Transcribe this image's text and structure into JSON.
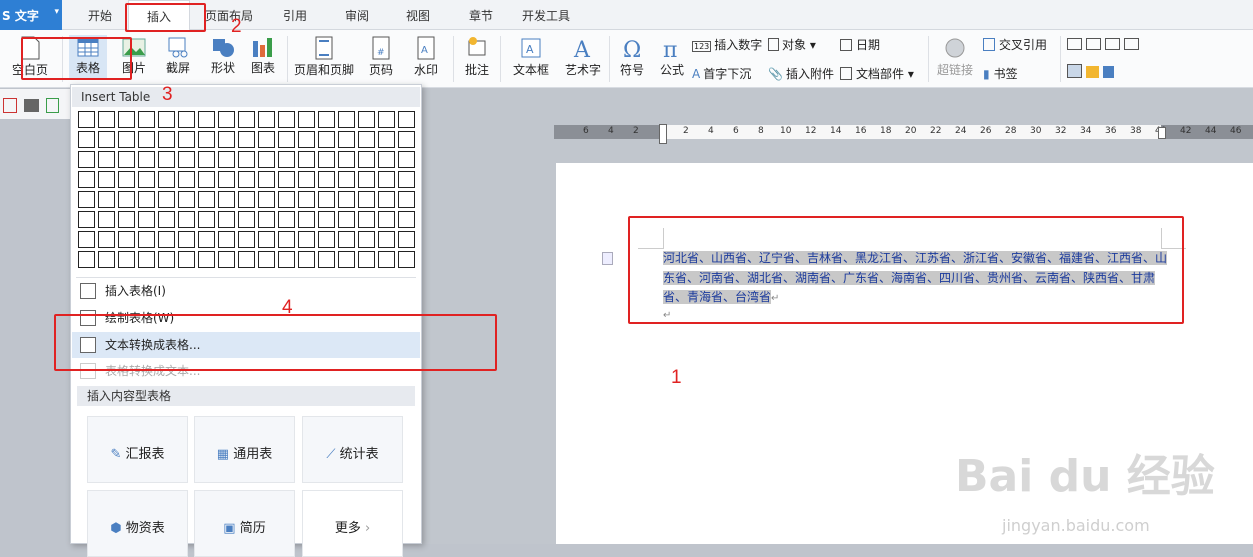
{
  "app": {
    "name": "S 文字"
  },
  "tabs": [
    "开始",
    "插入",
    "页面布局",
    "引用",
    "审阅",
    "视图",
    "章节",
    "开发工具"
  ],
  "ribbon": {
    "blank_page": "空白页",
    "table": "表格",
    "picture": "图片",
    "screenshot": "截屏",
    "shape": "形状",
    "chart": "图表",
    "header_footer": "页眉和页脚",
    "page_number": "页码",
    "watermark": "水印",
    "comment": "批注",
    "textbox": "文本框",
    "wordart": "艺术字",
    "symbol": "符号",
    "formula": "公式",
    "insert_number": "插入数字",
    "object": "对象",
    "dropcap": "首字下沉",
    "attachment": "插入附件",
    "date": "日期",
    "doc_parts": "文档部件",
    "hyperlink": "超链接",
    "cross_ref": "交叉引用",
    "bookmark": "书签"
  },
  "ruler": {
    "ticks": [
      "6",
      "4",
      "2",
      "2",
      "4",
      "6",
      "8",
      "10",
      "12",
      "14",
      "16",
      "18",
      "20",
      "22",
      "24",
      "26",
      "28",
      "30",
      "32",
      "34",
      "36",
      "38",
      "40",
      "42",
      "44",
      "46"
    ]
  },
  "document": {
    "text": "河北省、山西省、辽宁省、吉林省、黑龙江省、江苏省、浙江省、安徽省、福建省、江西省、山东省、河南省、湖北省、湖南省、广东省、海南省、四川省、贵州省、云南省、陕西省、甘肃省、青海省、台湾省"
  },
  "dropdown": {
    "title": "Insert Table",
    "items": [
      "插入表格(I)",
      "绘制表格(W)",
      "文本转换成表格...",
      "表格转换成文本..."
    ],
    "section": "插入内容型表格",
    "cards": [
      "汇报表",
      "通用表",
      "统计表",
      "物资表",
      "简历",
      "更多"
    ]
  },
  "annotations": [
    "2",
    "3",
    "4",
    "1"
  ],
  "watermark": {
    "brand": "Bai du 经验",
    "url": "jingyan.baidu.com"
  },
  "colors": {
    "accent": "#2e7fd4",
    "annotation": "#e02222",
    "doc_text": "#1b3a9c",
    "highlight": "#c8c8c8"
  }
}
